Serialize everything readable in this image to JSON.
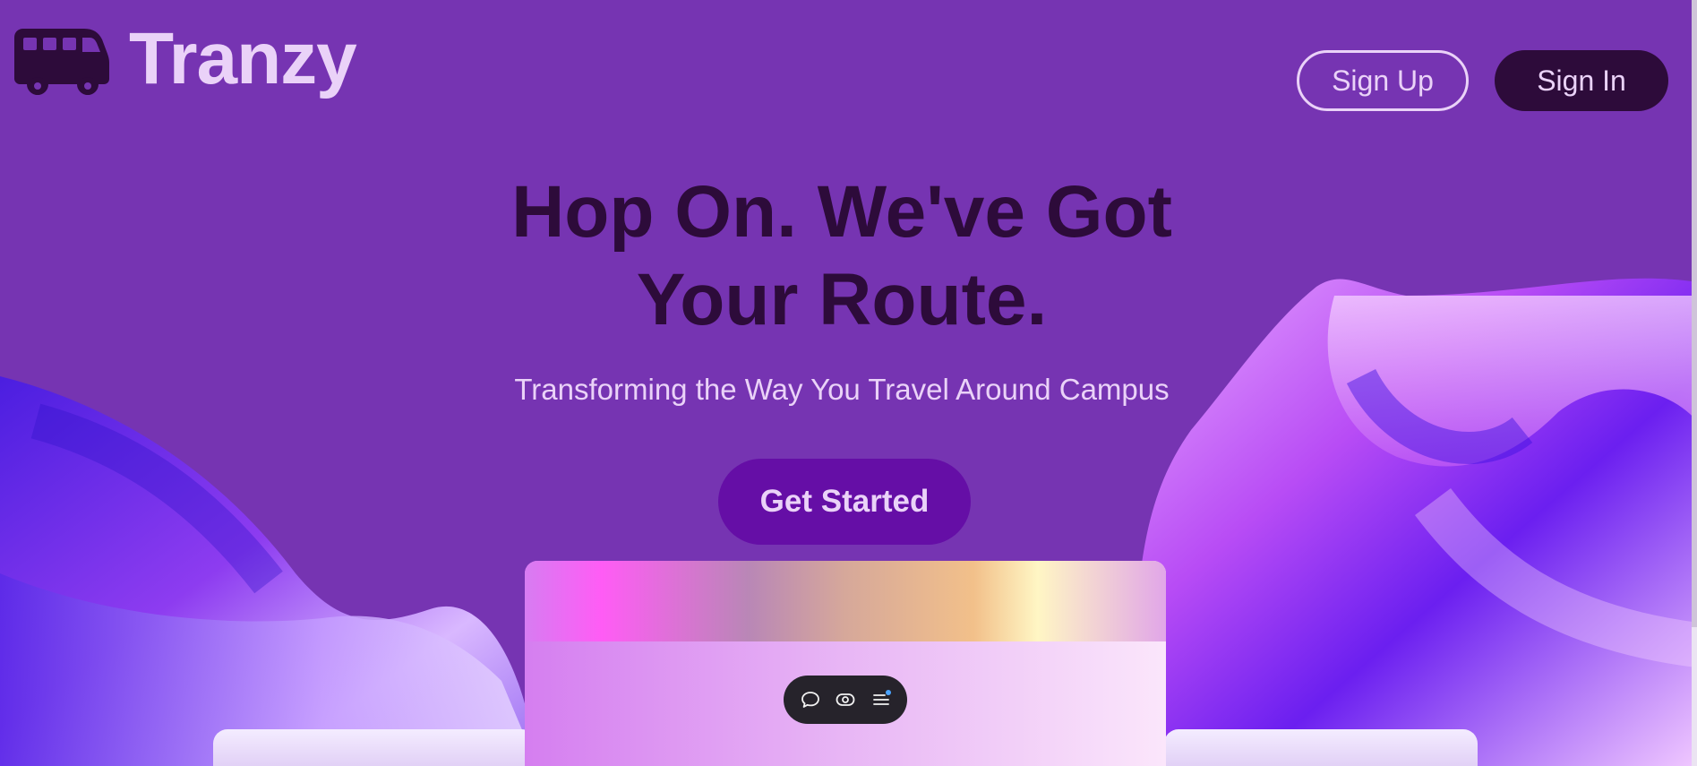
{
  "brand": {
    "name": "Tranzy",
    "logo_icon": "bus-icon"
  },
  "header": {
    "signup_label": "Sign Up",
    "signin_label": "Sign In"
  },
  "hero": {
    "title_line1": "Hop On. We've Got",
    "title_line2": "Your Route.",
    "subtitle": "Transforming the Way You Travel Around Campus",
    "cta_label": "Get Started"
  },
  "toolbar": {
    "icons": [
      "comment-icon",
      "eye-icon",
      "menu-icon"
    ]
  },
  "colors": {
    "background": "#7634b2",
    "title": "#2d0b3a",
    "light_text": "#ead2f8",
    "signin_bg": "#2d0b3a",
    "cta_bg": "#650ea6",
    "toolbar_bg": "#26232b",
    "notification": "#4aa3ff"
  }
}
